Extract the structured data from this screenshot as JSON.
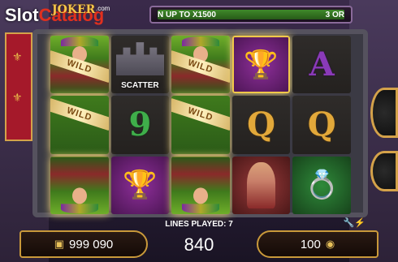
{
  "logo": {
    "brand_part1": "Slot",
    "brand_part2": "Catalog",
    "game_name": "JOKER",
    "suffix": ".com"
  },
  "ticker": {
    "left_text": "N UP TO X1500",
    "right_text": "3 OR"
  },
  "reels": [
    [
      "jester-wild",
      "jester",
      "jester-wild"
    ],
    [
      "scatter",
      "9",
      "goblet"
    ],
    [
      "jester-wild",
      "jester",
      "jester-wild"
    ],
    [
      "goblet",
      "Q",
      "lady"
    ],
    [
      "A",
      "Q",
      "ring"
    ]
  ],
  "symbols": {
    "scatter_label": "SCATTER",
    "wild_label": "WILD",
    "nine": "9",
    "queen": "Q",
    "ace": "A"
  },
  "status": {
    "lines_played": "LINES PLAYED: 7"
  },
  "balance": {
    "value": "999 090",
    "icon": "wallet-icon"
  },
  "win": {
    "value": "840"
  },
  "bet": {
    "value": "100",
    "icon": "coins-icon"
  },
  "colors": {
    "frame_gold": "#c9993a",
    "ticker_green": "#3f8a2a",
    "banner_red": "#a5192a"
  }
}
